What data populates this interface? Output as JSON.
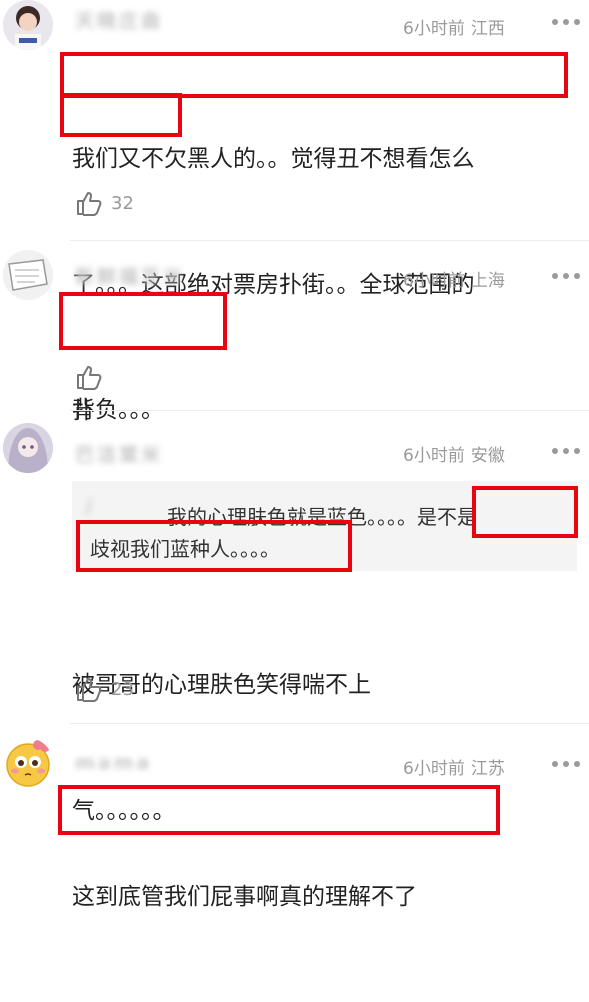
{
  "comments": [
    {
      "username": "天晓庄曲",
      "time": "6小时前",
      "location": "江西",
      "lines": [
        "我们又不欠黑人的。。觉得丑不想看怎么",
        "了。。。这部绝对票房扑街。。全球范围的",
        "扑"
      ],
      "likes": "32"
    },
    {
      "username": "新鲜福豆米",
      "time": "6小时前",
      "location": "上海",
      "lines": [
        "背负。。。"
      ],
      "likes": ""
    },
    {
      "username": "巴洁棠米",
      "time": "6小时前",
      "location": "安徽",
      "quote": {
        "author": "丿",
        "line1": "我的心理肤色就是蓝色。。。。是不是",
        "line2": "歧视我们蓝种人。。。。"
      },
      "lines": [
        "被哥哥的心理肤色笑得喘不上",
        "气。。。。。。"
      ],
      "likes": "23"
    },
    {
      "username": "mama",
      "time": "6小时前",
      "location": "江苏",
      "lines": [
        "这到底管我们屁事啊真的理解不了"
      ]
    }
  ],
  "colors": {
    "highlight": "#e8050f",
    "meta": "#9a9a9a",
    "text": "#222222"
  },
  "icons": [
    "more-dots-icon",
    "thumbs-up-icon"
  ]
}
